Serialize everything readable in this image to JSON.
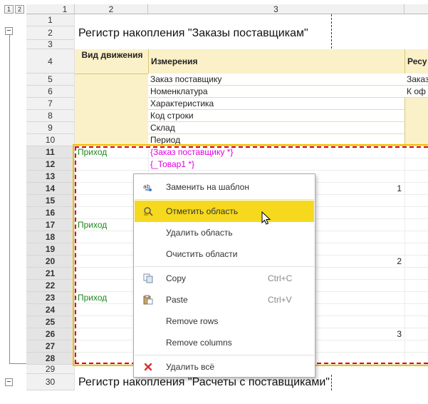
{
  "level_buttons": [
    "1",
    "2"
  ],
  "columns": [
    "1",
    "2",
    "3"
  ],
  "rows": [
    "1",
    "2",
    "3",
    "4",
    "5",
    "6",
    "7",
    "8",
    "9",
    "10",
    "11",
    "12",
    "13",
    "14",
    "15",
    "16",
    "17",
    "18",
    "19",
    "20",
    "21",
    "22",
    "23",
    "24",
    "25",
    "26",
    "27",
    "28",
    "29",
    "30"
  ],
  "sheet": {
    "title_top": "Регистр накопления \"Заказы поставщикам\"",
    "title_bottom": "Регистр накопления \"Расчеты с поставщиками\"",
    "header_vid": "Вид движения",
    "header_izmereniya": "Измерения",
    "header_resursy": "Ресу",
    "dimensions": [
      "Заказ поставщику",
      "Номенклатура",
      "Характеристика",
      "Код строки",
      "Склад",
      "Период"
    ],
    "resources": [
      "Заказ",
      "К оф"
    ],
    "prihod": "Приход",
    "param_order": "{Заказ поставщику *}",
    "param_tovar": "{_Товар1 *}",
    "counters": [
      "1",
      "2",
      "3"
    ]
  },
  "context_menu": {
    "items": [
      {
        "label": "Заменить на шаблон",
        "shortcut": "",
        "icon": "replace-template-icon"
      },
      {
        "label": "Отметить область",
        "shortcut": "",
        "icon": "mark-area-icon"
      },
      {
        "label": "Удалить область",
        "shortcut": "",
        "icon": ""
      },
      {
        "label": "Очистить области",
        "shortcut": "",
        "icon": ""
      },
      {
        "label": "Copy",
        "shortcut": "Ctrl+C",
        "icon": "copy-icon"
      },
      {
        "label": "Paste",
        "shortcut": "Ctrl+V",
        "icon": "paste-icon"
      },
      {
        "label": "Remove rows",
        "shortcut": "",
        "icon": ""
      },
      {
        "label": "Remove columns",
        "shortcut": "",
        "icon": ""
      },
      {
        "label": "Удалить всё",
        "shortcut": "",
        "icon": "delete-all-icon"
      }
    ],
    "highlighted_index": 1
  },
  "colors": {
    "highlight": "#f6d91f",
    "selection_dash": "#e00000",
    "selection_border": "#f0c000",
    "header_bg": "#fbf1c8",
    "green_text": "#1d8a1d",
    "magenta_text": "#e000e0"
  }
}
